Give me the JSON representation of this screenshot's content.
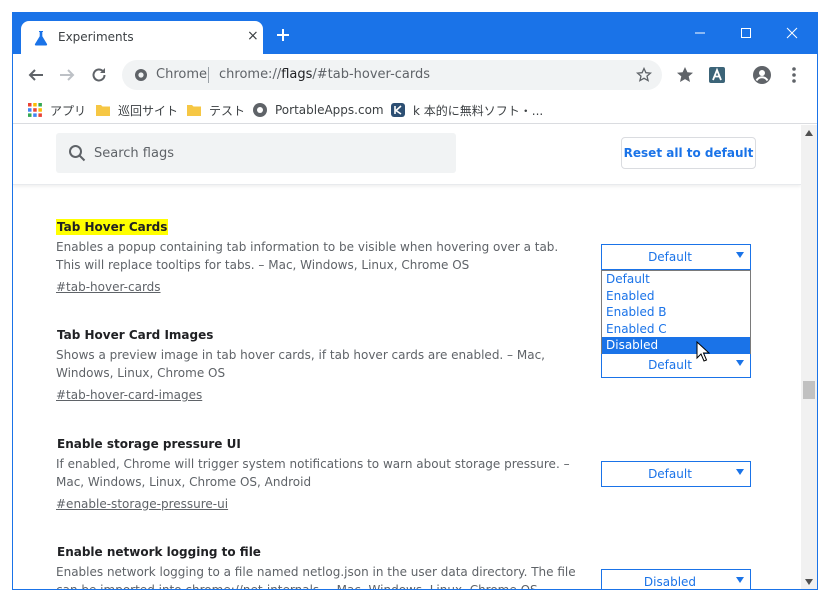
{
  "colors": {
    "accent": "#1a73e8",
    "highlight": "#ffff00"
  },
  "tab": {
    "title": "Experiments",
    "close": "×",
    "favicon": "flask-icon"
  },
  "window_controls": [
    "minimize-icon",
    "maximize-icon",
    "close-icon"
  ],
  "omnibox": {
    "site": "Chrome",
    "url_prefix": "chrome://",
    "url_host": "flags",
    "url_rest": "/#tab-hover-cards"
  },
  "bookmarks": [
    {
      "label": "アプリ",
      "icon": "apps-grid-icon"
    },
    {
      "label": "巡回サイト",
      "icon": "folder-icon"
    },
    {
      "label": "テスト",
      "icon": "folder-icon"
    },
    {
      "label": "PortableApps.com",
      "icon": "portableapps-icon"
    },
    {
      "label": "k 本的に無料ソフト・...",
      "icon": "k-site-icon"
    }
  ],
  "header": {
    "search_placeholder": "Search flags",
    "reset_label": "Reset all to default"
  },
  "experiments": [
    {
      "title": "Tab Hover Cards",
      "description": "Enables a popup containing tab information to be visible when hovering over a tab. This will replace tooltips for tabs. – Mac, Windows, Linux, Chrome OS",
      "link": "#tab-hover-cards",
      "value": "Default"
    },
    {
      "title": "Tab Hover Card Images",
      "description": "Shows a preview image in tab hover cards, if tab hover cards are enabled. – Mac, Windows, Linux, Chrome OS",
      "link": "#tab-hover-card-images",
      "value": "Default"
    },
    {
      "title": "Enable storage pressure UI",
      "description": "If enabled, Chrome will trigger system notifications to warn about storage pressure. – Mac, Windows, Linux, Chrome OS, Android",
      "link": "#enable-storage-pressure-ui",
      "value": "Default"
    },
    {
      "title": "Enable network logging to file",
      "description": "Enables network logging to a file named netlog.json in the user data directory. The file can be imported into chrome://net-internals. – Mac, Windows, Linux, Chrome OS, Android",
      "link": "",
      "value": "Disabled"
    }
  ],
  "dropdown": {
    "options": [
      "Default",
      "Enabled",
      "Enabled B",
      "Enabled C",
      "Disabled"
    ],
    "highlighted": "Disabled"
  }
}
